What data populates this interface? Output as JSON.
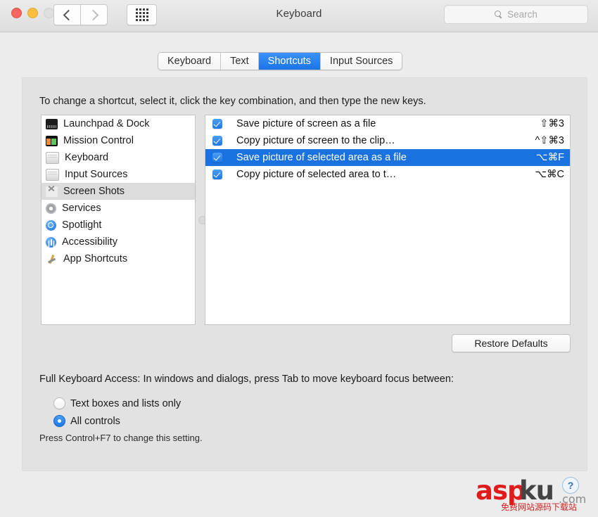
{
  "window": {
    "title": "Keyboard",
    "traffic_lights": [
      "close",
      "minimize",
      "zoom"
    ],
    "nav": {
      "back": "back-arrow",
      "forward": "forward-arrow",
      "grid": "show-all-grid"
    },
    "search": {
      "placeholder": "Search",
      "value": "",
      "icon": "search-icon"
    }
  },
  "tabs": [
    {
      "label": "Keyboard",
      "active": false
    },
    {
      "label": "Text",
      "active": false
    },
    {
      "label": "Shortcuts",
      "active": true
    },
    {
      "label": "Input Sources",
      "active": false
    }
  ],
  "instructions": "To change a shortcut, select it, click the key combination, and then type the new keys.",
  "sidebar": {
    "items": [
      {
        "label": "Launchpad & Dock",
        "icon": "dock-icon",
        "selected": false
      },
      {
        "label": "Mission Control",
        "icon": "mission-control-icon",
        "selected": false
      },
      {
        "label": "Keyboard",
        "icon": "keyboard-icon",
        "selected": false
      },
      {
        "label": "Input Sources",
        "icon": "keyboard-icon",
        "selected": false
      },
      {
        "label": "Screen Shots",
        "icon": "screenshot-icon",
        "selected": true
      },
      {
        "label": "Services",
        "icon": "gear-icon",
        "selected": false
      },
      {
        "label": "Spotlight",
        "icon": "spotlight-icon",
        "selected": false
      },
      {
        "label": "Accessibility",
        "icon": "accessibility-icon",
        "selected": false
      },
      {
        "label": "App Shortcuts",
        "icon": "xcode-hammer-icon",
        "selected": false
      }
    ]
  },
  "shortcuts": {
    "rows": [
      {
        "checked": true,
        "title": "Save picture of screen as a file",
        "keys": "⇧⌘3",
        "selected": false
      },
      {
        "checked": true,
        "title": "Copy picture of screen to the clip…",
        "keys": "^⇧⌘3",
        "selected": false
      },
      {
        "checked": true,
        "title": "Save picture of selected area as a file",
        "keys": "⌥⌘F",
        "selected": true
      },
      {
        "checked": true,
        "title": "Copy picture of selected area to t…",
        "keys": "⌥⌘C",
        "selected": false
      }
    ]
  },
  "restore_defaults_label": "Restore Defaults",
  "full_keyboard_access": {
    "description": "Full Keyboard Access: In windows and dialogs, press Tab to move keyboard focus between:",
    "options": [
      {
        "label": "Text boxes and lists only",
        "selected": false
      },
      {
        "label": "All controls",
        "selected": true
      }
    ],
    "hint": "Press Control+F7 to change this setting."
  },
  "watermark": {
    "part1": "asp",
    "part2": "ku",
    "bubble": "?",
    "domain": ".com",
    "subtitle": "免费网站源码下载站"
  },
  "colors": {
    "accent": "#1a72e0",
    "tab_active": "#1a73e8",
    "checkbox": "#1b78e8",
    "watermark_red": "#e01b1b"
  }
}
